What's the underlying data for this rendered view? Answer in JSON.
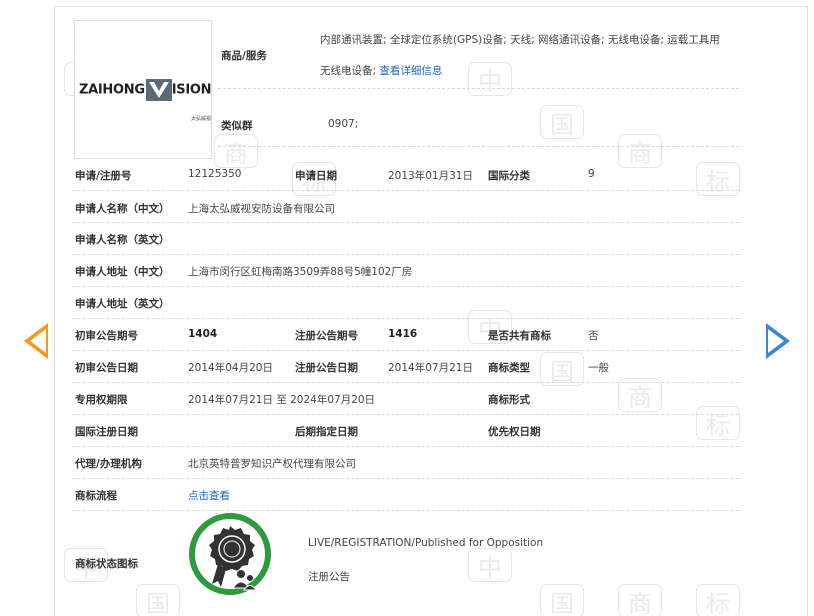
{
  "watermark": {
    "glyphs": [
      "中",
      "国",
      "商",
      "标"
    ]
  },
  "logo": {
    "brand": "ZAIHONG",
    "vision": "ISION",
    "sub": "太弘威视"
  },
  "goods": {
    "label": "商品/服务",
    "line1": "内部通讯装置; 全球定位系统(GPS)设备; 天线; 网络通讯设备; 无线电设备; 运载工具用",
    "line2": "无线电设备;",
    "detail_link": "查看详细信息"
  },
  "similar_group": {
    "label": "类似群",
    "value": "0907;"
  },
  "rows": {
    "reg_no": {
      "label": "申请/注册号",
      "value": "12125350"
    },
    "app_date": {
      "label": "申请日期",
      "value": "2013年01月31日"
    },
    "intl_class": {
      "label": "国际分类",
      "value": "9"
    },
    "applicant_cn": {
      "label": "申请人名称（中文）",
      "value": "上海太弘威视安防设备有限公司"
    },
    "applicant_en": {
      "label": "申请人名称（英文）",
      "value": ""
    },
    "address_cn": {
      "label": "申请人地址（中文）",
      "value": "上海市闵行区虹梅南路3509弄88号5幢102厂房"
    },
    "address_en": {
      "label": "申请人地址（英文）",
      "value": ""
    },
    "prelim_no": {
      "label": "初审公告期号",
      "value": "1404"
    },
    "reg_pub_no": {
      "label": "注册公告期号",
      "value": "1416"
    },
    "shared": {
      "label": "是否共有商标",
      "value": "否"
    },
    "prelim_date": {
      "label": "初审公告日期",
      "value": "2014年04月20日"
    },
    "reg_pub_date": {
      "label": "注册公告日期",
      "value": "2014年07月21日"
    },
    "tm_type": {
      "label": "商标类型",
      "value": "一般"
    },
    "exclusive": {
      "label": "专用权期限",
      "value": "2014年07月21日 至 2024年07月20日"
    },
    "tm_form": {
      "label": "商标形式",
      "value": ""
    },
    "intl_reg_date": {
      "label": "国际注册日期",
      "value": ""
    },
    "later_date": {
      "label": "后期指定日期",
      "value": ""
    },
    "priority_date": {
      "label": "优先权日期",
      "value": ""
    },
    "agency": {
      "label": "代理/办理机构",
      "value": "北京英特普罗知识产权代理有限公司"
    },
    "flow": {
      "label": "商标流程",
      "link": "点击查看"
    },
    "status": {
      "label": "商标状态图标",
      "line1": "LIVE/REGISTRATION/Published for Opposition",
      "line2": "注册公告"
    }
  },
  "colors": {
    "prev_arrow": "#f39a1e",
    "next_arrow": "#3a86d6",
    "status_ring": "#2e9a3e",
    "link": "#1a66c8"
  },
  "icons": {
    "prev": "chevron-left-icon",
    "next": "chevron-right-icon",
    "status": "rosette-icon"
  }
}
